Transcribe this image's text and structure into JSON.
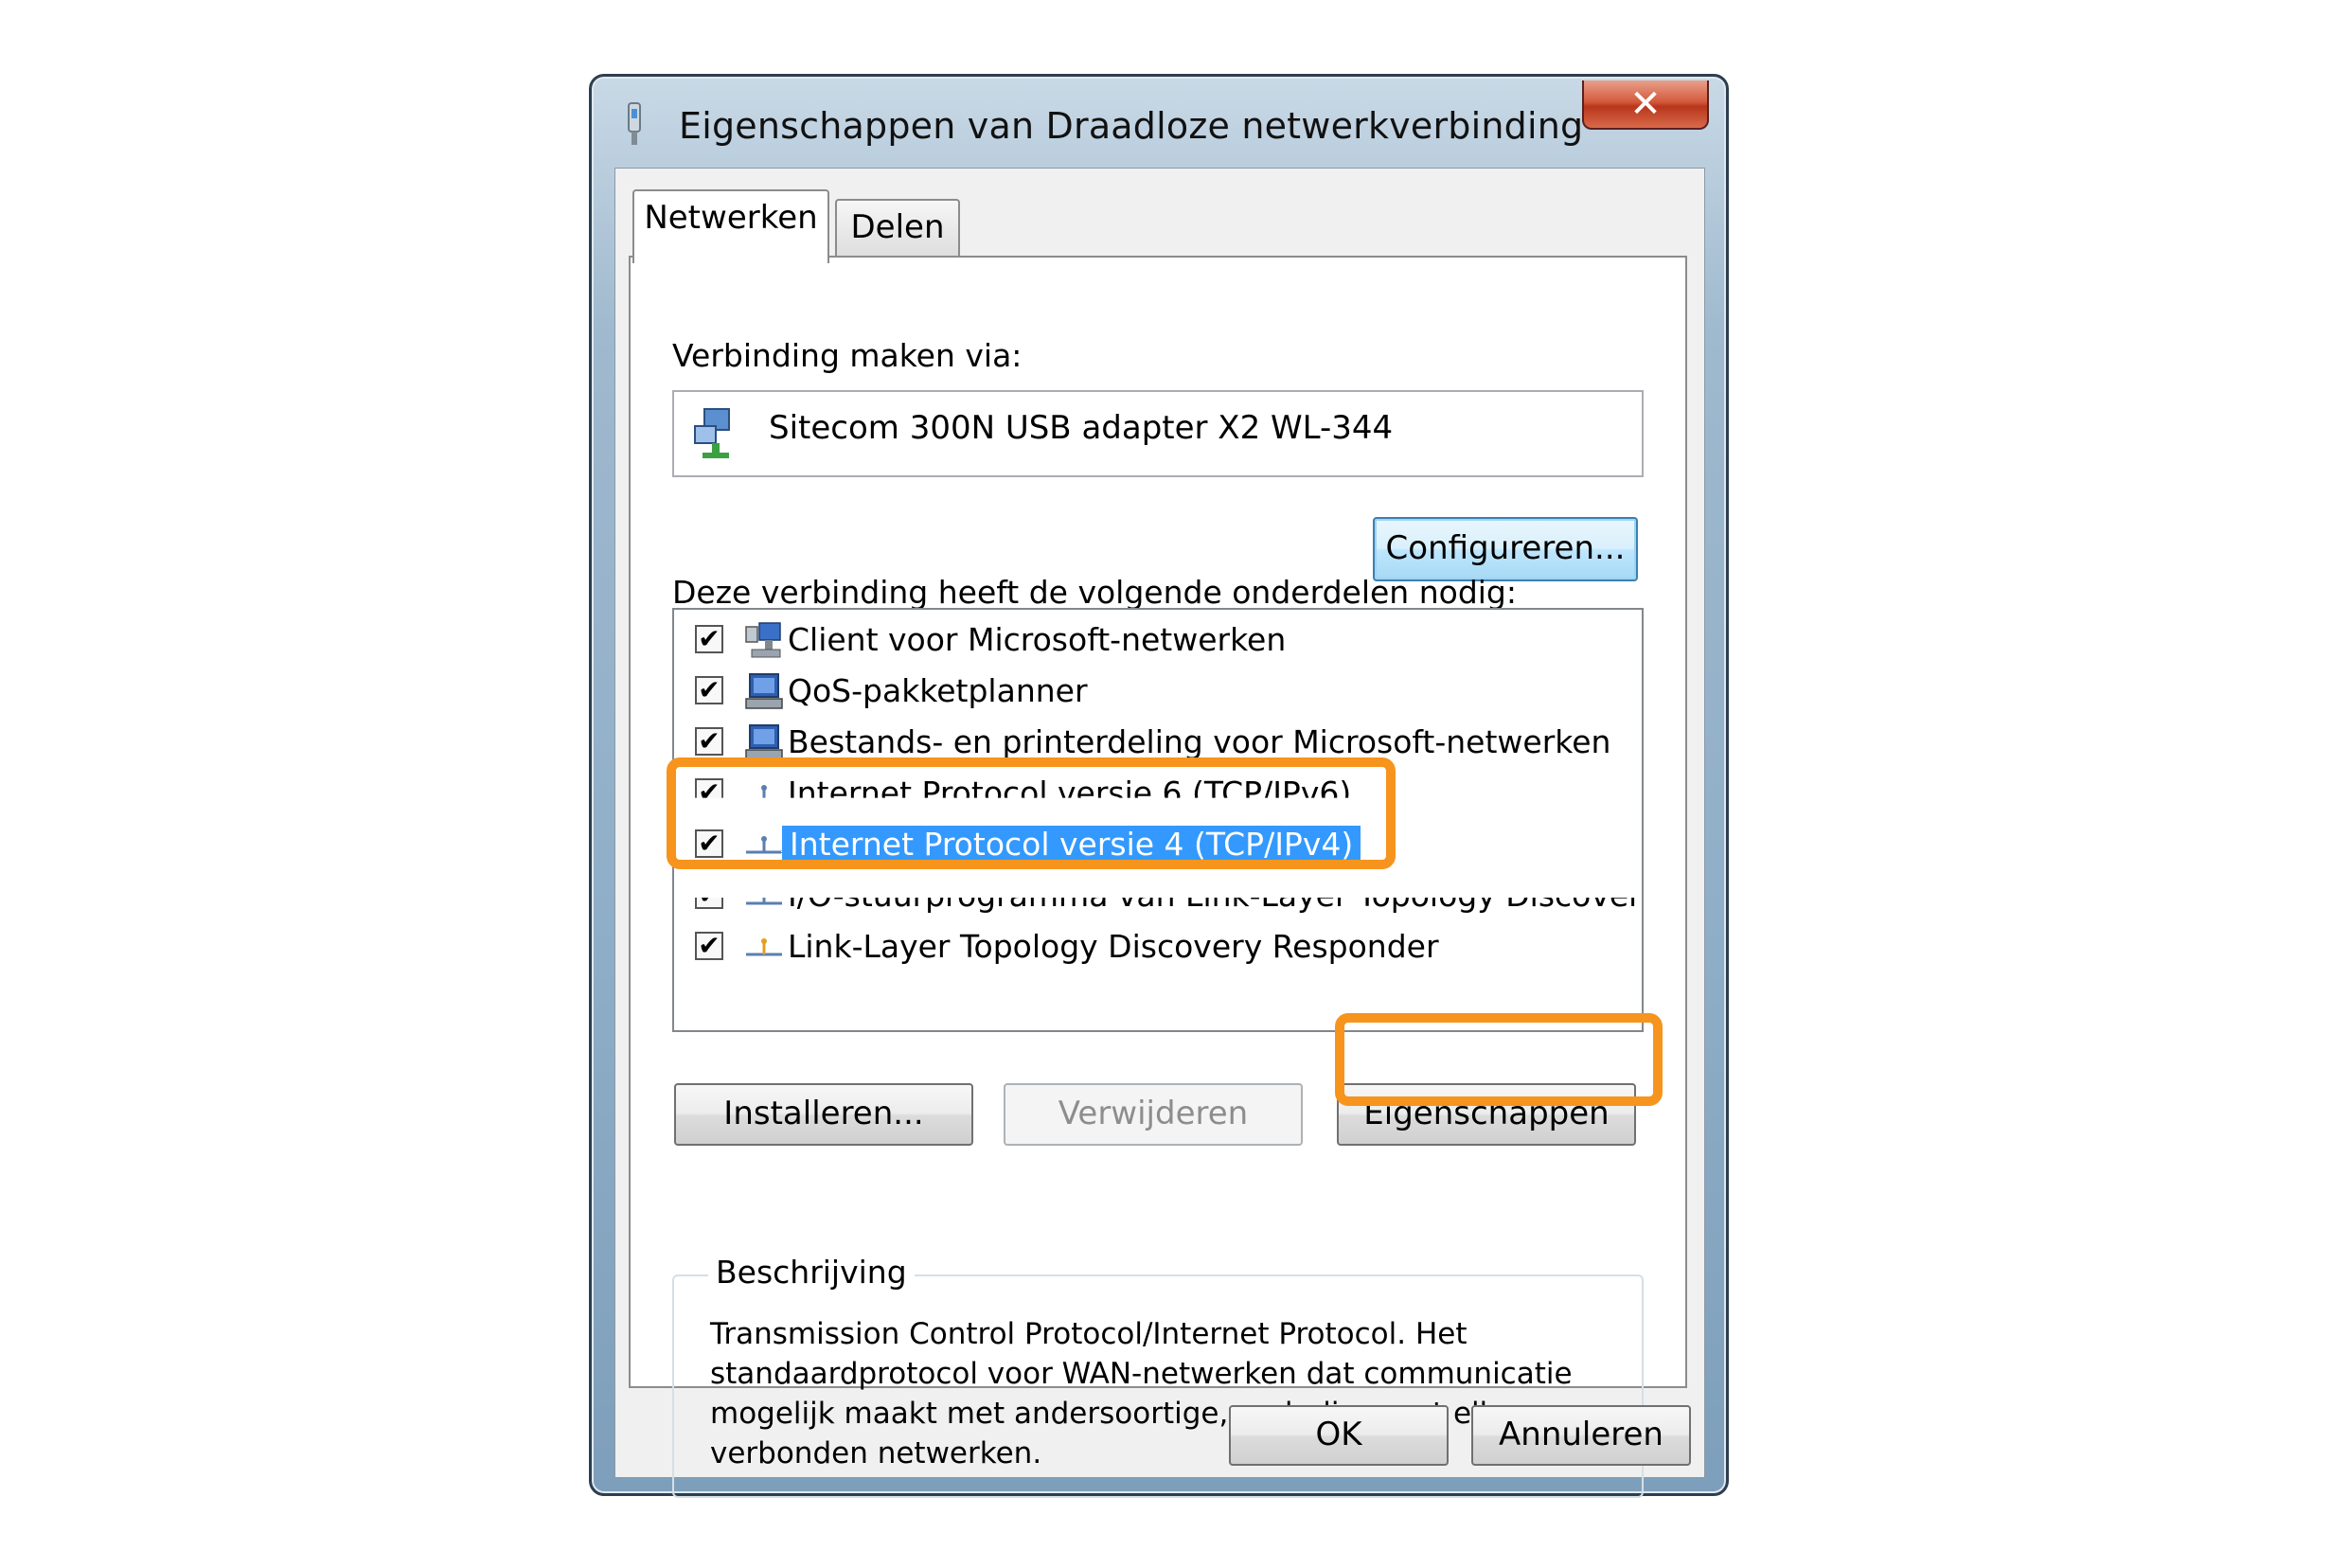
{
  "window": {
    "title": "Eigenschappen van Draadloze netwerkverbinding",
    "close_label": "✕"
  },
  "tabs": [
    {
      "label": "Netwerken",
      "active": true
    },
    {
      "label": "Delen",
      "active": false
    }
  ],
  "connect_via": {
    "label": "Verbinding maken via:",
    "adapter": "Sitecom 300N USB adapter X2 WL-344",
    "configure_button": "Configureren..."
  },
  "components": {
    "label": "Deze verbinding heeft de volgende onderdelen nodig:",
    "items": [
      {
        "label": "Client voor Microsoft-netwerken",
        "checked": true,
        "icon": "network-client-icon"
      },
      {
        "label": "QoS-pakketplanner",
        "checked": true,
        "icon": "computer-service-icon"
      },
      {
        "label": "Bestands- en printerdeling voor Microsoft-netwerken",
        "checked": true,
        "icon": "computer-service-icon"
      },
      {
        "label": "Internet Protocol versie 6 (TCP/IPv6)",
        "checked": true,
        "icon": "protocol-icon"
      },
      {
        "label": "Internet Protocol versie 4 (TCP/IPv4)",
        "checked": true,
        "icon": "protocol-icon",
        "selected": true
      },
      {
        "label": "I/O-stuurprogramma van Link-Layer Topology Discovery...",
        "checked": true,
        "icon": "protocol-icon"
      },
      {
        "label": "Link-Layer Topology Discovery Responder",
        "checked": true,
        "icon": "protocol-icon"
      }
    ],
    "check_mark": "✔"
  },
  "actions": {
    "install": "Installeren...",
    "remove": "Verwijderen",
    "properties": "Eigenschappen"
  },
  "description": {
    "title": "Beschrijving",
    "text": "Transmission Control Protocol/Internet Protocol. Het\nstandaardprotocol voor WAN-netwerken dat communicatie\nmogelijk maakt met andersoortige, onderling met elkaar\nverbonden netwerken."
  },
  "footer": {
    "ok": "OK",
    "cancel": "Annuleren"
  },
  "colors": {
    "highlight_orange": "#f7941d",
    "selection_blue": "#3399ff"
  }
}
